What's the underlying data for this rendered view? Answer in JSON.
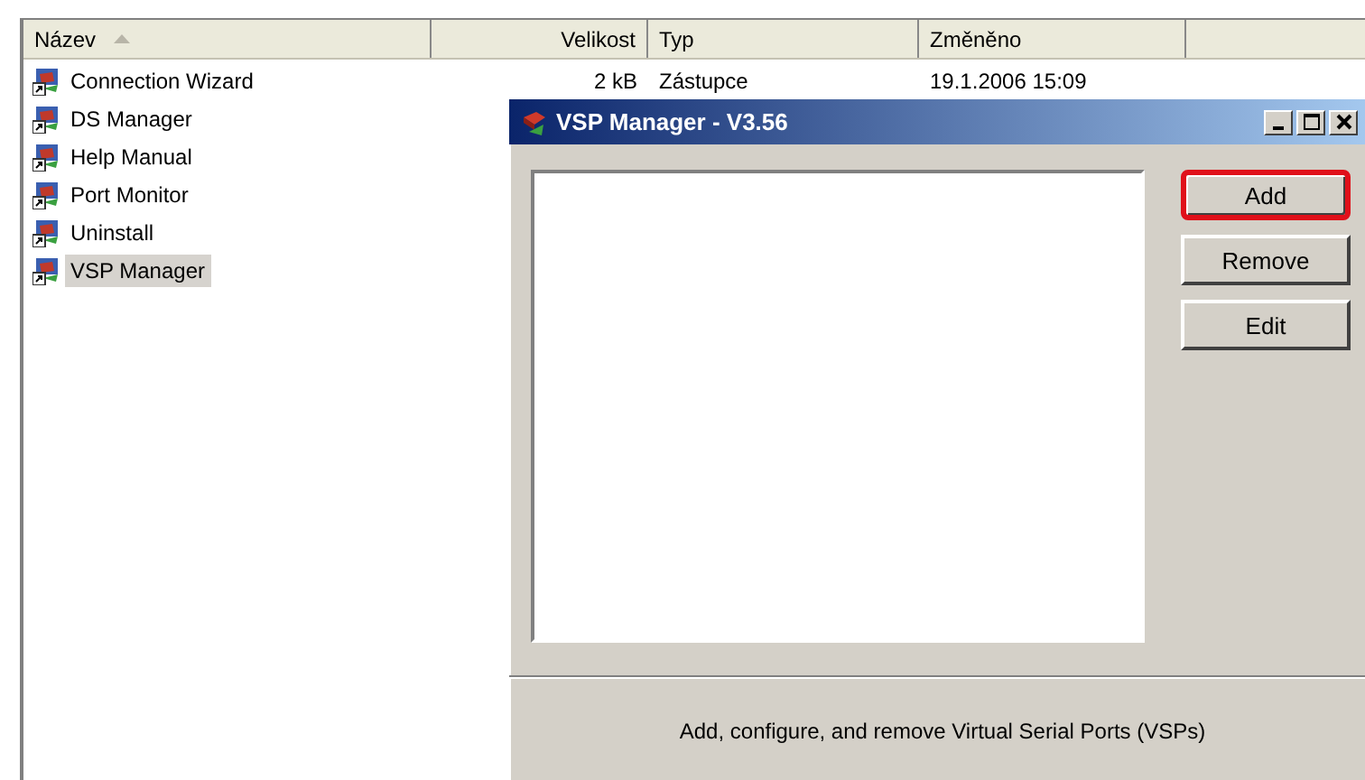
{
  "explorer": {
    "columns": [
      {
        "label": "Název",
        "sorted": true
      },
      {
        "label": "Velikost",
        "sorted": false
      },
      {
        "label": "Typ",
        "sorted": false
      },
      {
        "label": "Změněno",
        "sorted": false
      }
    ],
    "files": [
      {
        "name": "Connection Wizard",
        "size": "2 kB",
        "type": "Zástupce",
        "modified": "19.1.2006 15:09",
        "selected": false
      },
      {
        "name": "DS Manager",
        "selected": false
      },
      {
        "name": "Help Manual",
        "selected": false
      },
      {
        "name": "Port Monitor",
        "selected": false
      },
      {
        "name": "Uninstall",
        "selected": false
      },
      {
        "name": "VSP Manager",
        "selected": true
      }
    ]
  },
  "dialog": {
    "title": "VSP Manager - V3.56",
    "buttons": [
      {
        "label": "Add",
        "highlighted": true
      },
      {
        "label": "Remove",
        "highlighted": false
      },
      {
        "label": "Edit",
        "highlighted": false
      }
    ],
    "status": "Add, configure, and remove Virtual Serial Ports (VSPs)"
  }
}
